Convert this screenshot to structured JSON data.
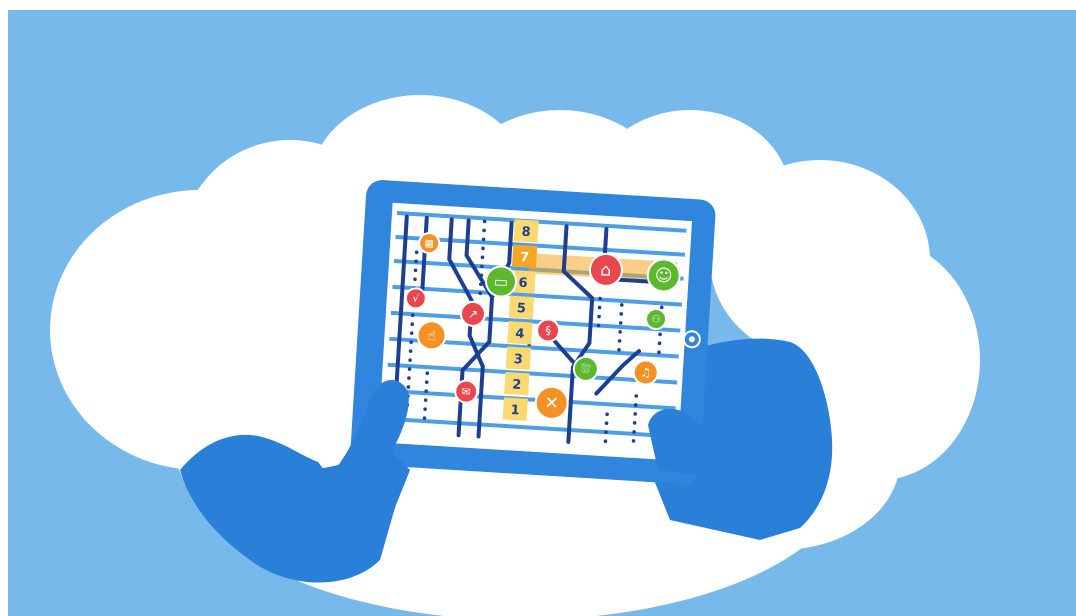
{
  "colors": {
    "sky": "#78b9ec",
    "cloud": "#ffffff",
    "device": "#2f86dc",
    "hand": "#2a7fd8",
    "screen": "#ffffff",
    "grid_line": "#4e9ee6",
    "track": "#1d3f92",
    "ladder": "#fbd971",
    "ladder_highlight": "#f5a623",
    "ladder_text": "#1d3f92",
    "icon_green": "#5cb82f",
    "icon_red": "#e8484d",
    "icon_orange": "#f39124"
  },
  "ladder_levels": [
    "8",
    "7",
    "6",
    "5",
    "4",
    "3",
    "2",
    "1"
  ],
  "icons": [
    {
      "name": "calculator-icon",
      "color": "orange",
      "glyph": "▦"
    },
    {
      "name": "checkmark-icon",
      "color": "red",
      "glyph": "√"
    },
    {
      "name": "pointing-hand-icon",
      "color": "orange",
      "glyph": "☝"
    },
    {
      "name": "chart-icon",
      "color": "red",
      "glyph": "↗"
    },
    {
      "name": "folder-icon",
      "color": "green",
      "glyph": "▭"
    },
    {
      "name": "mail-icon",
      "color": "red",
      "glyph": "✉"
    },
    {
      "name": "paragraph-icon",
      "color": "red",
      "glyph": "§"
    },
    {
      "name": "house-icon",
      "color": "red",
      "glyph": "⌂"
    },
    {
      "name": "face-icon",
      "color": "green",
      "glyph": "☺"
    },
    {
      "name": "people-icon",
      "color": "green",
      "glyph": "⚇"
    },
    {
      "name": "music-icon",
      "color": "orange",
      "glyph": "♫"
    },
    {
      "name": "shower-icon",
      "color": "green",
      "glyph": "⛆"
    },
    {
      "name": "tools-icon",
      "color": "orange",
      "glyph": "✕"
    }
  ]
}
